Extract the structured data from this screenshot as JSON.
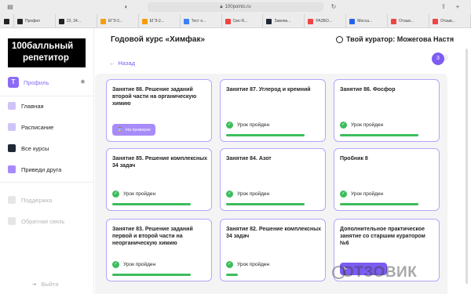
{
  "browser": {
    "url": "100points.ru",
    "tabs": [
      {
        "label": "Профил",
        "fav": "#222"
      },
      {
        "label": "23, 34...",
        "fav": "#222"
      },
      {
        "label": "ЕГЭ-2...",
        "fav": "#f59e0b"
      },
      {
        "label": "ЕГЭ-2...",
        "fav": "#f59e0b"
      },
      {
        "label": "Тест н...",
        "fav": "#3b82f6"
      },
      {
        "label": "Сво-Я...",
        "fav": "#ef4444"
      },
      {
        "label": "Завоев...",
        "fav": "#1f2937"
      },
      {
        "label": "РАЗБО...",
        "fav": "#ef4444"
      },
      {
        "label": "Месса...",
        "fav": "#2563eb"
      },
      {
        "label": "Отзыв...",
        "fav": "#ef4444"
      },
      {
        "label": "Отзыв...",
        "fav": "#ef4444"
      }
    ]
  },
  "sidebar": {
    "logo_line1": "100балльный",
    "logo_line2": "репетитор",
    "profile_letter": "Т",
    "profile_label": "Профиль",
    "nav": [
      {
        "label": "Главная",
        "color": "#cfc3f8"
      },
      {
        "label": "Расписание",
        "color": "#cfc3f8"
      },
      {
        "label": "Все курсы",
        "color": "#1f2937"
      },
      {
        "label": "Приведи друга",
        "color": "#a78bfa"
      }
    ],
    "nav_dim": [
      {
        "label": "Поддержка"
      },
      {
        "label": "Обратная связь"
      }
    ],
    "logout": "Выйти"
  },
  "main": {
    "course_title": "Годовой курс «Химфак»",
    "curator": "Твой куратор: Можегова Настя",
    "back": "Назад",
    "badge": "3",
    "cards": [
      {
        "title": "Занятие 88. Решение заданий второй части на органическую химию",
        "status": "На проверке",
        "kind": "review"
      },
      {
        "title": "Занятие 87. Углерод и кремний",
        "status": "Урок пройден",
        "kind": "done",
        "progress": 1
      },
      {
        "title": "Занятие 86. Фосфор",
        "status": "Урок пройден",
        "kind": "done",
        "progress": 1
      },
      {
        "title": "Занятие 85. Решение комплексных 34 задач",
        "status": "Урок пройден",
        "kind": "done",
        "progress": 1
      },
      {
        "title": "Занятие 84. Азот",
        "status": "Урок пройден",
        "kind": "done",
        "progress": 1
      },
      {
        "title": "Пробник 8",
        "status": "Урок пройден",
        "kind": "done",
        "progress": 1
      },
      {
        "title": "Занятие 83. Решение заданий первой и второй части на неорганическую химию",
        "status": "Урок пройден",
        "kind": "done",
        "progress": 1
      },
      {
        "title": "Занятие 82. Решение комплексных 34 задач",
        "status": "Урок пройден",
        "kind": "done",
        "progress": 0.15
      },
      {
        "title": "Дополнительное практическое занятие со старшим куратором №6",
        "status": "",
        "kind": "action"
      }
    ]
  },
  "watermark": "ОТЗОВИК"
}
